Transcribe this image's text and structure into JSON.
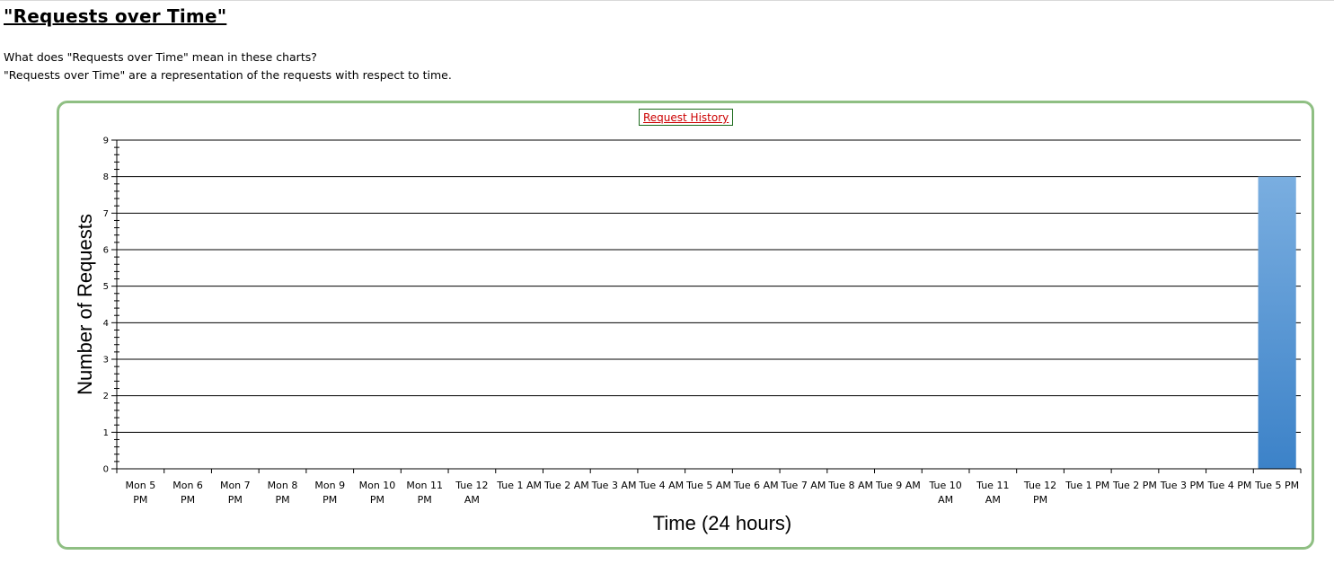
{
  "page": {
    "title": "\"Requests over Time\"",
    "question": "What does \"Requests over Time\" mean in these charts?",
    "answer": "\"Requests over Time\" are a representation of the requests with respect to time."
  },
  "colors": {
    "frame_border": "#8fbf83",
    "bar_top": "#7aaee0",
    "bar_bottom": "#3c82c8",
    "gridline": "#000000",
    "legend_text": "#cc0000",
    "legend_border": "#1c6b1c"
  },
  "chart_data": {
    "type": "bar",
    "xlabel": "Time (24 hours)",
    "ylabel": "Number of Requests",
    "ylim": [
      0,
      9
    ],
    "yticks": [
      0,
      1,
      2,
      3,
      4,
      5,
      6,
      7,
      8,
      9
    ],
    "grid": true,
    "legend": "top-center",
    "categories": [
      [
        "Mon 5",
        "PM"
      ],
      [
        "Mon 6",
        "PM"
      ],
      [
        "Mon 7",
        "PM"
      ],
      [
        "Mon 8",
        "PM"
      ],
      [
        "Mon 9",
        "PM"
      ],
      [
        "Mon 10",
        "PM"
      ],
      [
        "Mon 11",
        "PM"
      ],
      [
        "Tue 12",
        "AM"
      ],
      [
        "Tue 1 AM"
      ],
      [
        "Tue 2 AM"
      ],
      [
        "Tue 3 AM"
      ],
      [
        "Tue 4 AM"
      ],
      [
        "Tue 5 AM"
      ],
      [
        "Tue 6 AM"
      ],
      [
        "Tue 7 AM"
      ],
      [
        "Tue 8 AM"
      ],
      [
        "Tue 9 AM"
      ],
      [
        "Tue 10",
        "AM"
      ],
      [
        "Tue 11",
        "AM"
      ],
      [
        "Tue 12",
        "PM"
      ],
      [
        "Tue 1 PM"
      ],
      [
        "Tue 2 PM"
      ],
      [
        "Tue 3 PM"
      ],
      [
        "Tue 4 PM"
      ],
      [
        "Tue 5 PM"
      ]
    ],
    "series": [
      {
        "name": "Request History",
        "values": [
          0,
          0,
          0,
          0,
          0,
          0,
          0,
          0,
          0,
          0,
          0,
          0,
          0,
          0,
          0,
          0,
          0,
          0,
          0,
          0,
          0,
          0,
          0,
          0,
          8
        ]
      }
    ]
  }
}
